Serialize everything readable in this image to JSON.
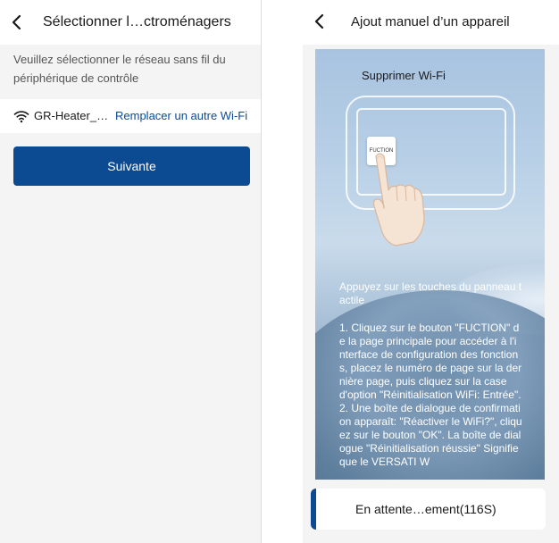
{
  "left_screen": {
    "title": "Sélectionner l…ctroménagers",
    "description": "Veuillez sélectionner le réseau sans fil du périphérique de contrôle",
    "wifi_name": "GR-Heater_…",
    "replace_wifi_label": "Remplacer un autre Wi-Fi",
    "next_button_label": "Suivante",
    "icons": {
      "back": "chevron-left-icon",
      "wifi": "wifi-icon"
    },
    "colors": {
      "accent": "#0c4a92",
      "link": "#0b4a94"
    }
  },
  "right_screen": {
    "title": "Ajout manuel d’un appareil",
    "guide": {
      "delete_wifi_label": "Supprimer  Wi-Fi",
      "function_button_label": "FUCTION",
      "touch_instruction": "Appuyez sur les touches du panneau tactile",
      "steps_text": "1. Cliquez sur le bouton \"FUCTION\" de la page principale pour accéder à l'interface de configuration des fonctions, placez le numéro de page sur la dernière page, puis cliquez sur la case d'option \"Réinitialisation WiFi: Entrée\".\n2. Une boîte de dialogue de confirmation apparaît: \"Réactiver le WiFi?\", cliquez sur le bouton \"OK\". La boîte de dialogue \"Réinitialisation réussie\" Signifie que le VERSATI W"
    },
    "status_text": "En attente…ement(116S)",
    "icons": {
      "back": "chevron-left-icon",
      "hand": "pointing-hand-icon"
    }
  }
}
